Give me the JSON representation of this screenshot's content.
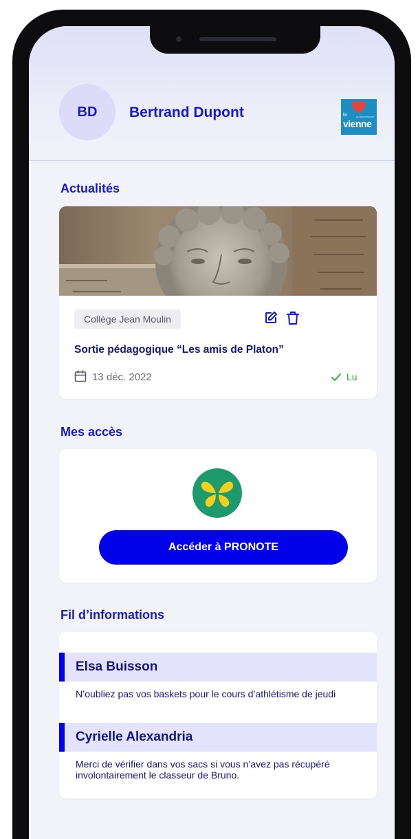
{
  "user": {
    "initials": "BD",
    "name": "Bertrand Dupont"
  },
  "brand": {
    "la": "la",
    "sub": "LE DÉPARTEMENT",
    "vienne": "vienne",
    "color": "#1d8ec2",
    "heart_color": "#e8433a"
  },
  "news": {
    "section_title": "Actualités",
    "school": "Collège Jean Moulin",
    "title": "Sortie pédagogique “Les amis de Platon”",
    "date": "13 déc. 2022",
    "status": "Lu",
    "icons": [
      "edit-icon",
      "delete-icon",
      "calendar-icon",
      "check-icon"
    ]
  },
  "access": {
    "section_title": "Mes accès",
    "button_label": "Accéder à PRONOTE",
    "button_color": "#0202ea"
  },
  "feed": {
    "section_title": "Fil d’informations",
    "items": [
      {
        "author": "Elsa Buisson",
        "message": "N’oubliez pas vos baskets pour le cours d’athlétisme de jeudi"
      },
      {
        "author": "Cyrielle Alexandria",
        "message": "Merci de vérifier dans vos sacs si vous n’avez pas récupéré involontairement le classeur de Bruno."
      }
    ]
  },
  "colors": {
    "accent": "#1818c8",
    "text_dark": "#14147e",
    "success": "#2da52d",
    "background": "#f2f3f9"
  }
}
